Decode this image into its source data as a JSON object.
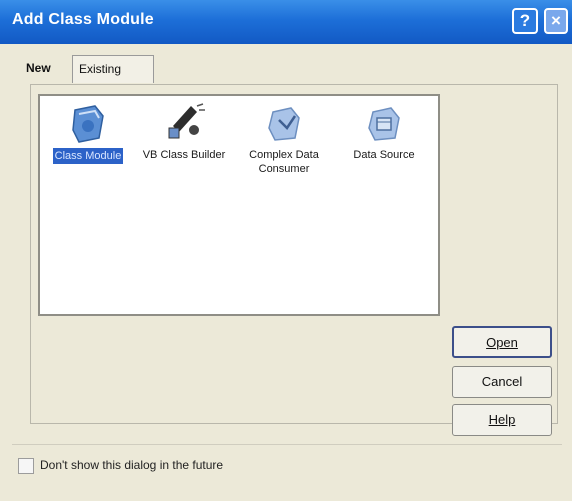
{
  "window": {
    "title": "Add Class Module",
    "help_glyph": "?",
    "close_glyph": "×"
  },
  "tabs": [
    {
      "label": "New",
      "active": true
    },
    {
      "label": "Existing",
      "active": false
    }
  ],
  "items": [
    {
      "label": "Class Module",
      "icon": "class-module-icon",
      "selected": true
    },
    {
      "label": "VB Class Builder",
      "icon": "vb-class-builder-icon",
      "selected": false
    },
    {
      "label": "Complex Data Consumer",
      "icon": "complex-data-consumer-icon",
      "selected": false
    },
    {
      "label": "Data Source",
      "icon": "data-source-icon",
      "selected": false
    }
  ],
  "buttons": {
    "open": "Open",
    "cancel": "Cancel",
    "help": "Help"
  },
  "checkbox": {
    "label": "Don't show this dialog in the future",
    "checked": false
  },
  "colors": {
    "titlebar": "#1d6fd8",
    "selection": "#2c62c8"
  }
}
